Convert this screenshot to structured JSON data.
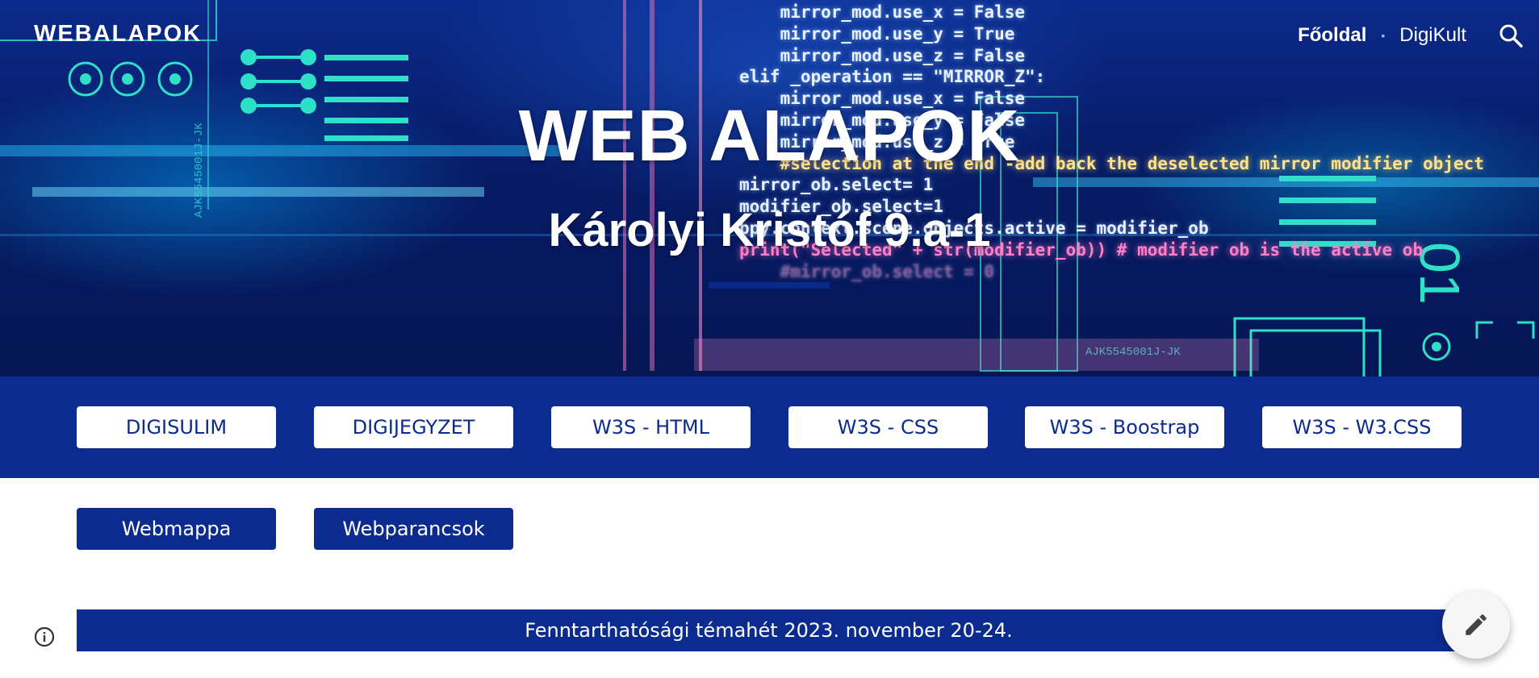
{
  "header": {
    "brand": "WEBALAPOK",
    "nav": [
      {
        "label": "Főoldal",
        "active": true
      },
      {
        "label": "DigiKult",
        "active": false
      }
    ],
    "search_icon": "search-icon"
  },
  "hero": {
    "title": "WEB ALAPOK",
    "subtitle": "Károlyi Kristóf 9.a-1",
    "code_lines": [
      "    mirror_mod.use_x = False",
      "    mirror_mod.use_y = True",
      "    mirror_mod.use_z = False",
      "elif _operation == \"MIRROR_Z\":",
      "    mirror_mod.use_x = False",
      "    mirror_mod.use_y = False",
      "    mirror_mod.use_z = True",
      "    #selection at the end -add back the deselected mirror modifier object",
      "mirror_ob.select= 1",
      "modifier_ob.select=1",
      "bpy.context.scene.objects.active = modifier_ob",
      "print(\"Selected\" + str(modifier_ob)) # modifier ob is the active ob",
      "    #mirror_ob.select = 0"
    ]
  },
  "link_buttons": [
    "DIGISULIM",
    "DIGIJEGYZET",
    "W3S - HTML",
    "W3S - CSS",
    "W3S - Boostrap",
    "W3S - W3.CSS"
  ],
  "secondary_buttons": [
    "Webmappa",
    "Webparancsok"
  ],
  "announcement": "Fenntarthatósági témahét 2023. november 20-24.",
  "icons": {
    "info": "info-icon",
    "edit": "edit-icon"
  },
  "colors": {
    "primary": "#0c2b8f",
    "hero_bg": "#071b66",
    "white": "#ffffff"
  }
}
